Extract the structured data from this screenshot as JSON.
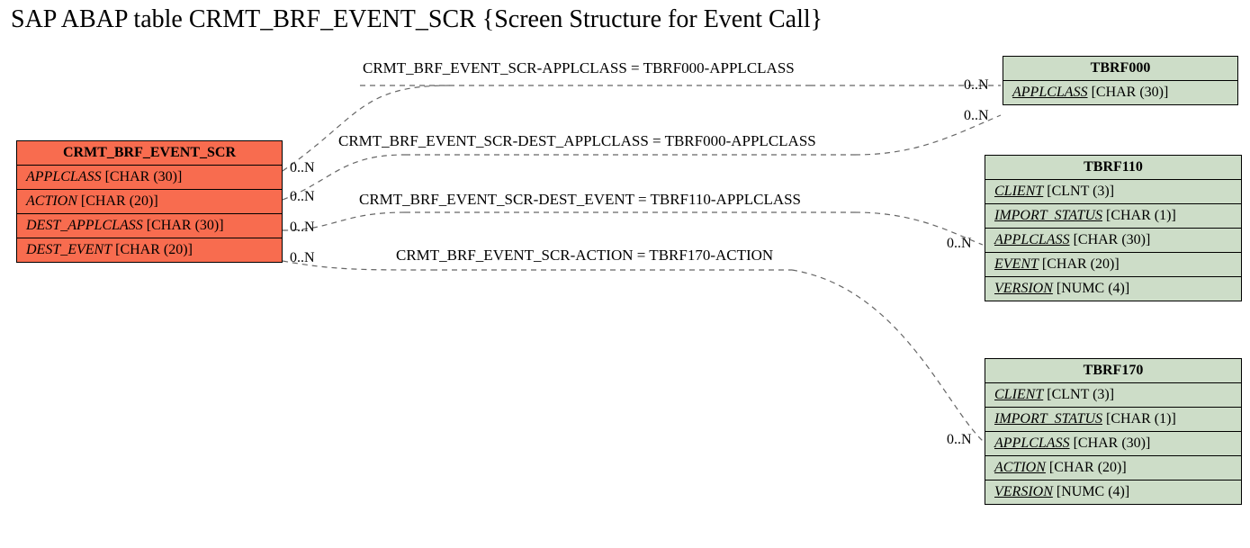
{
  "title": "SAP ABAP table CRMT_BRF_EVENT_SCR {Screen Structure for Event Call}",
  "source": {
    "name": "CRMT_BRF_EVENT_SCR",
    "fields": [
      {
        "name": "APPLCLASS",
        "type": "[CHAR (30)]"
      },
      {
        "name": "ACTION",
        "type": "[CHAR (20)]"
      },
      {
        "name": "DEST_APPLCLASS",
        "type": "[CHAR (30)]"
      },
      {
        "name": "DEST_EVENT",
        "type": "[CHAR (20)]"
      }
    ]
  },
  "targets": {
    "t1": {
      "name": "TBRF000",
      "fields": [
        {
          "name": "APPLCLASS",
          "type": "[CHAR (30)]",
          "underline": true
        }
      ]
    },
    "t2": {
      "name": "TBRF110",
      "fields": [
        {
          "name": "CLIENT",
          "type": "[CLNT (3)]",
          "underline": true
        },
        {
          "name": "IMPORT_STATUS",
          "type": "[CHAR (1)]",
          "underline": true
        },
        {
          "name": "APPLCLASS",
          "type": "[CHAR (30)]",
          "underline": true
        },
        {
          "name": "EVENT",
          "type": "[CHAR (20)]",
          "underline": true
        },
        {
          "name": "VERSION",
          "type": "[NUMC (4)]",
          "underline": true
        }
      ]
    },
    "t3": {
      "name": "TBRF170",
      "fields": [
        {
          "name": "CLIENT",
          "type": "[CLNT (3)]",
          "underline": true
        },
        {
          "name": "IMPORT_STATUS",
          "type": "[CHAR (1)]",
          "underline": true
        },
        {
          "name": "APPLCLASS",
          "type": "[CHAR (30)]",
          "underline": true
        },
        {
          "name": "ACTION",
          "type": "[CHAR (20)]",
          "underline": true
        },
        {
          "name": "VERSION",
          "type": "[NUMC (4)]",
          "underline": true
        }
      ]
    }
  },
  "relations": [
    {
      "label": "CRMT_BRF_EVENT_SCR-APPLCLASS = TBRF000-APPLCLASS",
      "card_src": "0..N",
      "card_tgt": "0..N"
    },
    {
      "label": "CRMT_BRF_EVENT_SCR-DEST_APPLCLASS = TBRF000-APPLCLASS",
      "card_src": "0..N",
      "card_tgt": "0..N"
    },
    {
      "label": "CRMT_BRF_EVENT_SCR-DEST_EVENT = TBRF110-APPLCLASS",
      "card_src": "0..N",
      "card_tgt": "0..N"
    },
    {
      "label": "CRMT_BRF_EVENT_SCR-ACTION = TBRF170-ACTION",
      "card_src": "0..N",
      "card_tgt": "0..N"
    }
  ]
}
